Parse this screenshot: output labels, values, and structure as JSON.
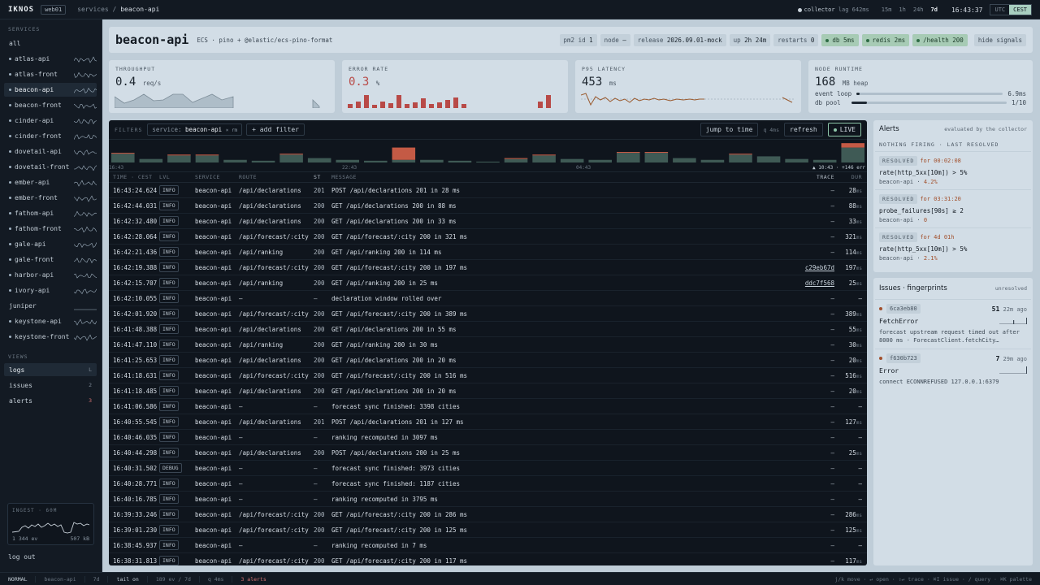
{
  "topbar": {
    "logo": "IKNOS",
    "env": "web01",
    "crumb_parent": "services",
    "crumb_sep": "/",
    "crumb_current": "beacon-api",
    "collector": "collector",
    "lag": "lag 642ms",
    "ranges": [
      "15m",
      "1h",
      "24h",
      "7d"
    ],
    "active_range": "7d",
    "clock": "16:43:37",
    "tz": [
      "UTC",
      "CEST"
    ],
    "active_tz": "CEST"
  },
  "sidebar": {
    "services_heading": "SERVICES",
    "all_label": "all",
    "services": [
      {
        "name": "atlas-api",
        "dot": true,
        "spark": true,
        "active": false
      },
      {
        "name": "atlas-front",
        "dot": true,
        "spark": true,
        "active": false
      },
      {
        "name": "beacon-api",
        "dot": true,
        "spark": true,
        "active": true
      },
      {
        "name": "beacon-front",
        "dot": true,
        "spark": true,
        "active": false
      },
      {
        "name": "cinder-api",
        "dot": true,
        "spark": true,
        "active": false
      },
      {
        "name": "cinder-front",
        "dot": true,
        "spark": true,
        "active": false
      },
      {
        "name": "dovetail-api",
        "dot": true,
        "spark": true,
        "active": false
      },
      {
        "name": "dovetail-front",
        "dot": true,
        "spark": true,
        "active": false
      },
      {
        "name": "ember-api",
        "dot": true,
        "spark": true,
        "active": false
      },
      {
        "name": "ember-front",
        "dot": true,
        "spark": true,
        "active": false
      },
      {
        "name": "fathom-api",
        "dot": true,
        "spark": true,
        "active": false
      },
      {
        "name": "fathom-front",
        "dot": true,
        "spark": true,
        "active": false
      },
      {
        "name": "gale-api",
        "dot": true,
        "spark": true,
        "active": false
      },
      {
        "name": "gale-front",
        "dot": true,
        "spark": true,
        "active": false
      },
      {
        "name": "harbor-api",
        "dot": true,
        "spark": true,
        "active": false
      },
      {
        "name": "ivory-api",
        "dot": true,
        "spark": true,
        "active": false
      },
      {
        "name": "juniper",
        "dot": false,
        "spark": false,
        "active": false
      },
      {
        "name": "keystone-api",
        "dot": true,
        "spark": true,
        "active": false
      },
      {
        "name": "keystone-front",
        "dot": true,
        "spark": true,
        "active": false
      }
    ],
    "views_heading": "VIEWS",
    "views": [
      {
        "label": "logs",
        "count": "L",
        "active": true,
        "red": false
      },
      {
        "label": "issues",
        "count": "2",
        "active": false,
        "red": false
      },
      {
        "label": "alerts",
        "count": "3",
        "active": false,
        "red": true
      }
    ],
    "ingest": {
      "heading": "INGEST · 60M",
      "events": "1 344 ev",
      "bytes": "507 kB"
    },
    "logout": "log out"
  },
  "header": {
    "service": "beacon-api",
    "format": "ECS · pino + @elastic/ecs-pino-format",
    "pm2_label": "pm2 id",
    "pm2_value": "1",
    "node_label": "node",
    "node_value": "—",
    "release_label": "release",
    "release_value": "2026.09.01-mock",
    "up_label": "up",
    "up_value": "2h 24m",
    "restarts_label": "restarts",
    "restarts_value": "0",
    "health": [
      "db 5ms",
      "redis 2ms",
      "/health 200"
    ],
    "hide_signals": "hide signals"
  },
  "metrics": {
    "throughput": {
      "heading": "THROUGHPUT",
      "value": "0.4",
      "unit": "req/s"
    },
    "error_rate": {
      "heading": "ERROR RATE",
      "value": "0.3",
      "unit": "%"
    },
    "p95": {
      "heading": "P95 LATENCY",
      "value": "453",
      "unit": "ms"
    },
    "runtime": {
      "heading": "NODE RUNTIME",
      "value": "168",
      "unit": "MB heap",
      "event_loop_label": "event loop",
      "event_loop_value": "6.9ms",
      "event_loop_fill": 0.02,
      "db_pool_label": "db pool",
      "db_pool_value": "1/10",
      "db_pool_fill": 0.1
    }
  },
  "filters": {
    "label": "FILTERS",
    "tag_key": "service:",
    "tag_value": "beacon-api",
    "tag_close": "× rm",
    "add_filter": "+ add filter",
    "jump": "jump to time",
    "latency": "q 4ms",
    "refresh": "refresh",
    "live": "LIVE"
  },
  "histogram": {
    "ticks": [
      "16:43",
      "22:43",
      "04:43",
      "10:43"
    ],
    "now_label": "+146 err",
    "bars": [
      {
        "info": 10,
        "err": 1
      },
      {
        "info": 4,
        "err": 0
      },
      {
        "info": 8,
        "err": 1
      },
      {
        "info": 8,
        "err": 1
      },
      {
        "info": 3,
        "err": 0
      },
      {
        "info": 2,
        "err": 0
      },
      {
        "info": 9,
        "err": 1
      },
      {
        "info": 5,
        "err": 0
      },
      {
        "info": 3,
        "err": 0
      },
      {
        "info": 2,
        "err": 0
      },
      {
        "info": 3,
        "err": 14
      },
      {
        "info": 3,
        "err": 0
      },
      {
        "info": 2,
        "err": 0
      },
      {
        "info": 1,
        "err": 0
      },
      {
        "info": 4,
        "err": 1
      },
      {
        "info": 8,
        "err": 1
      },
      {
        "info": 4,
        "err": 0
      },
      {
        "info": 3,
        "err": 0
      },
      {
        "info": 11,
        "err": 1
      },
      {
        "info": 11,
        "err": 1
      },
      {
        "info": 5,
        "err": 0
      },
      {
        "info": 3,
        "err": 0
      },
      {
        "info": 9,
        "err": 1
      },
      {
        "info": 7,
        "err": 0
      },
      {
        "info": 4,
        "err": 0
      },
      {
        "info": 3,
        "err": 0
      },
      {
        "info": 17,
        "err": 5
      }
    ]
  },
  "table": {
    "headers": {
      "time": "TIME · CEST",
      "lvl": "LVL",
      "service": "SERVICE",
      "route": "ROUTE",
      "st": "ST",
      "message": "MESSAGE",
      "trace": "TRACE",
      "dur": "DUR"
    },
    "rows": [
      {
        "time": "16:43:24.624",
        "lvl": "INFO",
        "svc": "beacon-api",
        "route": "/api/declarations",
        "st": "201",
        "msg": "POST /api/declarations 201 in 28 ms",
        "trace": "–",
        "dur": "28",
        "unit": "ms"
      },
      {
        "time": "16:42:44.031",
        "lvl": "INFO",
        "svc": "beacon-api",
        "route": "/api/declarations",
        "st": "200",
        "msg": "GET /api/declarations 200 in 88 ms",
        "trace": "–",
        "dur": "88",
        "unit": "ms"
      },
      {
        "time": "16:42:32.480",
        "lvl": "INFO",
        "svc": "beacon-api",
        "route": "/api/declarations",
        "st": "200",
        "msg": "GET /api/declarations 200 in 33 ms",
        "trace": "–",
        "dur": "33",
        "unit": "ms"
      },
      {
        "time": "16:42:28.064",
        "lvl": "INFO",
        "svc": "beacon-api",
        "route": "/api/forecast/:city",
        "st": "200",
        "msg": "GET /api/forecast/:city 200 in 321 ms",
        "trace": "–",
        "dur": "321",
        "unit": "ms"
      },
      {
        "time": "16:42:21.436",
        "lvl": "INFO",
        "svc": "beacon-api",
        "route": "/api/ranking",
        "st": "200",
        "msg": "GET /api/ranking 200 in 114 ms",
        "trace": "–",
        "dur": "114",
        "unit": "ms"
      },
      {
        "time": "16:42:19.388",
        "lvl": "INFO",
        "svc": "beacon-api",
        "route": "/api/forecast/:city",
        "st": "200",
        "msg": "GET /api/forecast/:city 200 in 197 ms",
        "trace": "c29eb67d",
        "dur": "197",
        "unit": "ms"
      },
      {
        "time": "16:42:15.707",
        "lvl": "INFO",
        "svc": "beacon-api",
        "route": "/api/ranking",
        "st": "200",
        "msg": "GET /api/ranking 200 in 25 ms",
        "trace": "ddc7f568",
        "dur": "25",
        "unit": "ms"
      },
      {
        "time": "16:42:10.055",
        "lvl": "INFO",
        "svc": "beacon-api",
        "route": "–",
        "st": "–",
        "msg": "declaration window rolled over",
        "trace": "–",
        "dur": "–",
        "unit": ""
      },
      {
        "time": "16:42:01.920",
        "lvl": "INFO",
        "svc": "beacon-api",
        "route": "/api/forecast/:city",
        "st": "200",
        "msg": "GET /api/forecast/:city 200 in 389 ms",
        "trace": "–",
        "dur": "389",
        "unit": "ms"
      },
      {
        "time": "16:41:48.388",
        "lvl": "INFO",
        "svc": "beacon-api",
        "route": "/api/declarations",
        "st": "200",
        "msg": "GET /api/declarations 200 in 55 ms",
        "trace": "–",
        "dur": "55",
        "unit": "ms"
      },
      {
        "time": "16:41:47.110",
        "lvl": "INFO",
        "svc": "beacon-api",
        "route": "/api/ranking",
        "st": "200",
        "msg": "GET /api/ranking 200 in 30 ms",
        "trace": "–",
        "dur": "30",
        "unit": "ms"
      },
      {
        "time": "16:41:25.653",
        "lvl": "INFO",
        "svc": "beacon-api",
        "route": "/api/declarations",
        "st": "200",
        "msg": "GET /api/declarations 200 in 20 ms",
        "trace": "–",
        "dur": "20",
        "unit": "ms"
      },
      {
        "time": "16:41:18.631",
        "lvl": "INFO",
        "svc": "beacon-api",
        "route": "/api/forecast/:city",
        "st": "200",
        "msg": "GET /api/forecast/:city 200 in 516 ms",
        "trace": "–",
        "dur": "516",
        "unit": "ms"
      },
      {
        "time": "16:41:18.485",
        "lvl": "INFO",
        "svc": "beacon-api",
        "route": "/api/declarations",
        "st": "200",
        "msg": "GET /api/declarations 200 in 20 ms",
        "trace": "–",
        "dur": "20",
        "unit": "ms"
      },
      {
        "time": "16:41:06.586",
        "lvl": "INFO",
        "svc": "beacon-api",
        "route": "–",
        "st": "–",
        "msg": "forecast sync finished: 3398 cities",
        "trace": "–",
        "dur": "–",
        "unit": ""
      },
      {
        "time": "16:40:55.545",
        "lvl": "INFO",
        "svc": "beacon-api",
        "route": "/api/declarations",
        "st": "201",
        "msg": "POST /api/declarations 201 in 127 ms",
        "trace": "–",
        "dur": "127",
        "unit": "ms"
      },
      {
        "time": "16:40:46.035",
        "lvl": "INFO",
        "svc": "beacon-api",
        "route": "–",
        "st": "–",
        "msg": "ranking recomputed in 3097 ms",
        "trace": "–",
        "dur": "–",
        "unit": ""
      },
      {
        "time": "16:40:44.298",
        "lvl": "INFO",
        "svc": "beacon-api",
        "route": "/api/declarations",
        "st": "200",
        "msg": "POST /api/declarations 200 in 25 ms",
        "trace": "–",
        "dur": "25",
        "unit": "ms"
      },
      {
        "time": "16:40:31.502",
        "lvl": "DEBUG",
        "svc": "beacon-api",
        "route": "–",
        "st": "–",
        "msg": "forecast sync finished: 3973 cities",
        "trace": "–",
        "dur": "–",
        "unit": ""
      },
      {
        "time": "16:40:28.771",
        "lvl": "INFO",
        "svc": "beacon-api",
        "route": "–",
        "st": "–",
        "msg": "forecast sync finished: 1187 cities",
        "trace": "–",
        "dur": "–",
        "unit": ""
      },
      {
        "time": "16:40:16.785",
        "lvl": "INFO",
        "svc": "beacon-api",
        "route": "–",
        "st": "–",
        "msg": "ranking recomputed in 3795 ms",
        "trace": "–",
        "dur": "–",
        "unit": ""
      },
      {
        "time": "16:39:33.246",
        "lvl": "INFO",
        "svc": "beacon-api",
        "route": "/api/forecast/:city",
        "st": "200",
        "msg": "GET /api/forecast/:city 200 in 286 ms",
        "trace": "–",
        "dur": "286",
        "unit": "ms"
      },
      {
        "time": "16:39:01.230",
        "lvl": "INFO",
        "svc": "beacon-api",
        "route": "/api/forecast/:city",
        "st": "200",
        "msg": "GET /api/forecast/:city 200 in 125 ms",
        "trace": "–",
        "dur": "125",
        "unit": "ms"
      },
      {
        "time": "16:38:45.937",
        "lvl": "INFO",
        "svc": "beacon-api",
        "route": "–",
        "st": "–",
        "msg": "ranking recomputed in 7 ms",
        "trace": "–",
        "dur": "–",
        "unit": ""
      },
      {
        "time": "16:38:31.813",
        "lvl": "INFO",
        "svc": "beacon-api",
        "route": "/api/forecast/:city",
        "st": "200",
        "msg": "GET /api/forecast/:city 200 in 117 ms",
        "trace": "–",
        "dur": "117",
        "unit": "ms"
      }
    ]
  },
  "alerts": {
    "title": "Alerts",
    "subtitle": "evaluated by the collector",
    "none_firing": "NOTHING FIRING · LAST RESOLVED",
    "items": [
      {
        "badge": "RESOLVED",
        "for": "for 00:02:08",
        "rule": "rate(http_5xx[10m]) > 5%",
        "svc": "beacon-api",
        "sep": "·",
        "val": "4.2%"
      },
      {
        "badge": "RESOLVED",
        "for": "for 03:31:20",
        "rule": "probe_failures[90s] ≥ 2",
        "svc": "beacon-api",
        "sep": "·",
        "val": "0"
      },
      {
        "badge": "RESOLVED",
        "for": "for 4d 01h",
        "rule": "rate(http_5xx[10m]) > 5%",
        "svc": "beacon-api",
        "sep": "·",
        "val": "2.1%"
      }
    ]
  },
  "issues": {
    "title": "Issues · fingerprints",
    "subtitle": "unresolved",
    "items": [
      {
        "fp": "6ca3eb80",
        "count": "51",
        "ago": "22m ago",
        "name": "FetchError",
        "desc": "forecast upstream request timed out after 8000 ms · ForecastClient.fetchCity…"
      },
      {
        "fp": "f630b723",
        "count": "7",
        "ago": "29m ago",
        "name": "Error",
        "desc": "connect ECONNREFUSED 127.0.0.1:6379"
      }
    ]
  },
  "statusbar": {
    "mode": "NORMAL",
    "svc": "beacon-api",
    "range": "7d",
    "tail": "tail on",
    "events": "189 ev / 7d",
    "q": "q 4ms",
    "alerts": "3 alerts",
    "keys": "j/k move · ↵ open · ⇧↵ trace · ⌘I issue · / query · ⌘K palette"
  }
}
